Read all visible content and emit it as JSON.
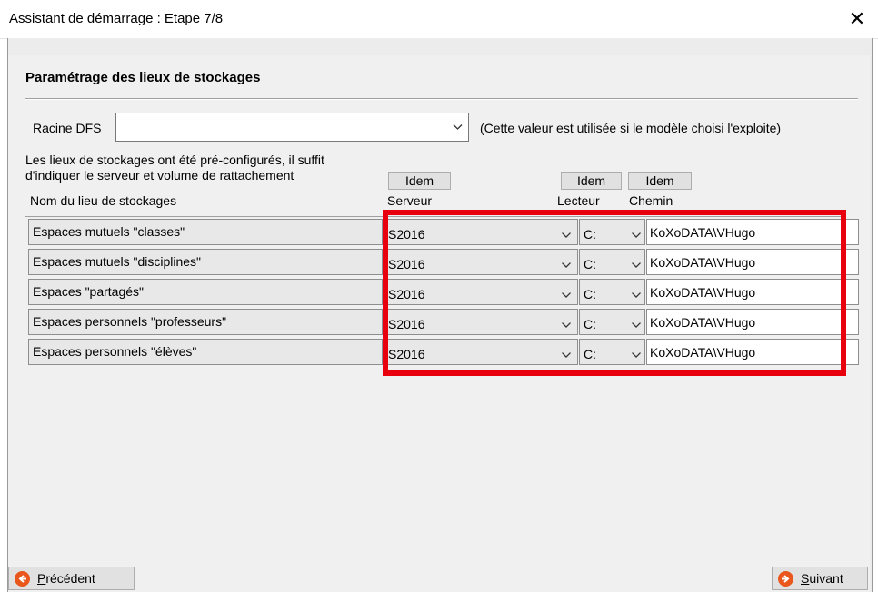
{
  "window": {
    "title": "Assistant de démarrage : Etape 7/8",
    "close_glyph": "✕"
  },
  "section": {
    "title": "Paramétrage des lieux de stockages"
  },
  "dfs": {
    "label": "Racine DFS",
    "value": "",
    "note": "(Cette valeur est utilisée si le modèle choisi l'exploite)"
  },
  "intro": {
    "line1": "Les lieux de stockages ont été pré-configurés, il suffit",
    "line2": "d'indiquer le serveur et volume de rattachement"
  },
  "idem_labels": {
    "server": "Idem",
    "drive": "Idem",
    "path": "Idem"
  },
  "columns": {
    "name": "Nom du lieu  de stockages",
    "server": "Serveur",
    "drive": "Lecteur",
    "path": "Chemin"
  },
  "rows": [
    {
      "name": "Espaces mutuels \"classes\"",
      "server": "S2016",
      "drive": "C:",
      "path": "KoXoDATA\\VHugo"
    },
    {
      "name": "Espaces mutuels \"disciplines\"",
      "server": "S2016",
      "drive": "C:",
      "path": "KoXoDATA\\VHugo"
    },
    {
      "name": "Espaces \"partagés\"",
      "server": "S2016",
      "drive": "C:",
      "path": "KoXoDATA\\VHugo"
    },
    {
      "name": "Espaces personnels \"professeurs\"",
      "server": "S2016",
      "drive": "C:",
      "path": "KoXoDATA\\VHugo"
    },
    {
      "name": "Espaces personnels \"élèves\"",
      "server": "S2016",
      "drive": "C:",
      "path": "KoXoDATA\\VHugo"
    }
  ],
  "nav": {
    "prev": {
      "mnemonic": "P",
      "rest": "récédent",
      "icon": "arrow-left-circle-icon"
    },
    "next": {
      "mnemonic": "S",
      "rest": "uivant",
      "icon": "arrow-right-circle-icon"
    }
  },
  "colors": {
    "highlight": "#e8000e",
    "nav_icon": "#e9571c"
  }
}
